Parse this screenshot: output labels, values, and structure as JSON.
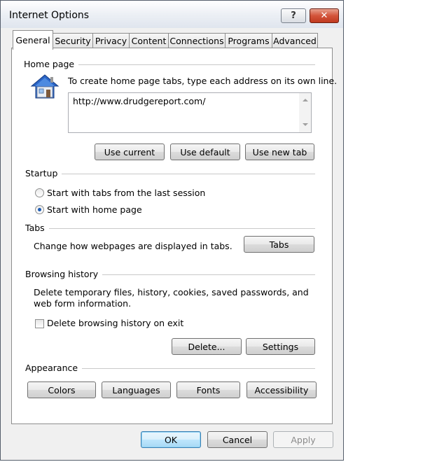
{
  "window": {
    "title": "Internet Options"
  },
  "titlebar": {
    "help_glyph": "?",
    "close_glyph": "✕"
  },
  "tabs": [
    {
      "label": "General"
    },
    {
      "label": "Security"
    },
    {
      "label": "Privacy"
    },
    {
      "label": "Content"
    },
    {
      "label": "Connections"
    },
    {
      "label": "Programs"
    },
    {
      "label": "Advanced"
    }
  ],
  "home_page": {
    "heading": "Home page",
    "instruction": "To create home page tabs, type each address on its own line.",
    "url": "http://www.drudgereport.com/",
    "buttons": {
      "use_current": "Use current",
      "use_default": "Use default",
      "use_new_tab": "Use new tab"
    }
  },
  "startup": {
    "heading": "Startup",
    "options": [
      {
        "label": "Start with tabs from the last session",
        "selected": false
      },
      {
        "label": "Start with home page",
        "selected": true
      }
    ]
  },
  "tabs_section": {
    "heading": "Tabs",
    "description": "Change how webpages are displayed in tabs.",
    "button": "Tabs"
  },
  "browsing_history": {
    "heading": "Browsing history",
    "description_line1": "Delete temporary files, history, cookies, saved passwords, and",
    "description_line2": "web form information.",
    "checkbox_label": "Delete browsing history on exit",
    "checkbox_checked": false,
    "buttons": {
      "delete": "Delete...",
      "settings": "Settings"
    }
  },
  "appearance": {
    "heading": "Appearance",
    "buttons": {
      "colors": "Colors",
      "languages": "Languages",
      "fonts": "Fonts",
      "accessibility": "Accessibility"
    }
  },
  "footer": {
    "ok": "OK",
    "cancel": "Cancel",
    "apply": "Apply"
  }
}
